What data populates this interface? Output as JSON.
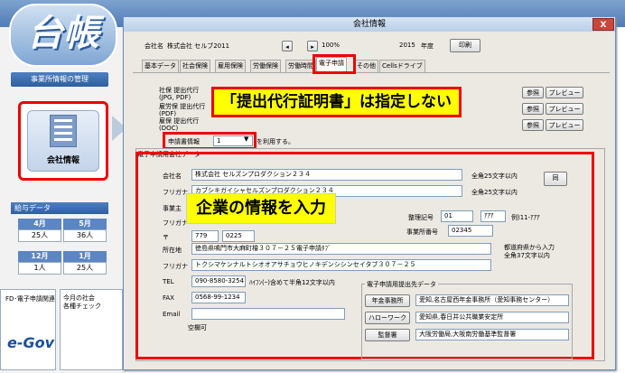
{
  "bg": {
    "logo_text": "台帳",
    "section_office": "事業所情報の管理",
    "office_button": "会社情報",
    "section_salary": "給与データ",
    "salary": [
      {
        "month": "4月",
        "count": "25人"
      },
      {
        "month": "5月",
        "count": "36人"
      },
      {
        "month": "12月",
        "count": "1人"
      },
      {
        "month": "1月",
        "count": "25人"
      }
    ],
    "fd_label": "FD･電子申請関連",
    "egov": "e-Gov",
    "check_label": "今月の社会\n各種チェック"
  },
  "dialog": {
    "title": "会社情報",
    "close": "X",
    "company_label": "会社名",
    "company_name": "株式会社 セルブ2011",
    "zoom": "100%",
    "year": "2015",
    "year_label": "年度",
    "print_button": "印刷",
    "tabs": [
      "基本データ",
      "社会保険",
      "雇用保険",
      "労働保険",
      "労働時間",
      "電子申請",
      "その他",
      "Cellsドライブ"
    ],
    "doc_labels": [
      "社保 提出代行\n(JPG, PDF)",
      "雇労保 提出代行\n(PDF)",
      "雇保 提出代行\n(DOC)"
    ],
    "ref_button": "参照",
    "preview_button": "プレビュー",
    "apply_info_label": "申請書情報",
    "apply_info_value": "1",
    "apply_info_suffix": "を利用する。",
    "group_title": "電子申請用会社データ",
    "company_field_label": "会社名",
    "company_field_value": "株式会社 セルズンプロダクション２３４",
    "kana_label": "フリガナ",
    "kana_value": "カブシキガイシャセルズンプロダクション２３４",
    "full25": "全角25文字以内",
    "same_button": "同",
    "owner_label": "事業主",
    "owner_kana_label": "フリガナ",
    "zip_label": "〒",
    "zip1": "779",
    "zip2": "0225",
    "seiri_label": "整理記号",
    "seiri1": "01",
    "seiri2": "ｱｱｱ",
    "seiri_hint": "例)11-ｱｱｱ",
    "office_no_label": "事業所番号",
    "office_no": "02345",
    "addr_label": "所在地",
    "addr_value": "徳島県鳴門市大麻町檜３０７－２５電子申請ﾀﾌﾞ",
    "addr_hint": "都道府県から入力\n全角37文字以内",
    "addr_kana_label": "フリガナ",
    "addr_kana_value": "トクシマケンナルトシオオアサチョウヒノキデンシシンセイタブ３０７－２５",
    "tel_label": "TEL",
    "tel_value": "090-8580-3254",
    "tel_hint": "ﾊｲﾌﾝ(ｰ)含めて半角12文字以内",
    "fax_label": "FAX",
    "fax_value": "0568-99-1234",
    "email_label": "Email",
    "email_hint": "空欄可",
    "dest_title": "電子申請用提出先データ",
    "dest": [
      {
        "button": "年金事務所",
        "value": "愛知,名古屋西年金事務所（愛知事務センター）"
      },
      {
        "button": "ハローワーク",
        "value": "愛知県,春日井公共職業安定所"
      },
      {
        "button": "監督署",
        "value": "大阪労働局,大阪南労働基準監督署"
      }
    ]
  },
  "callouts": {
    "top": "「提出代行証明書」は指定しない",
    "middle": "企業の情報を入力"
  }
}
